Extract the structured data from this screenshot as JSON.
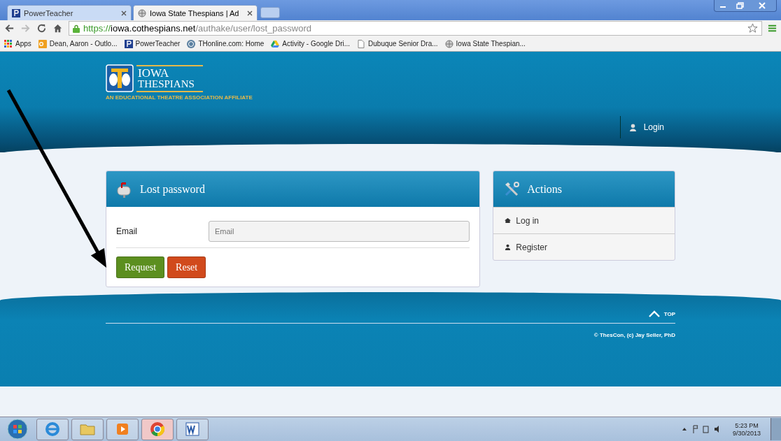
{
  "browser": {
    "tabs": [
      {
        "title": "PowerTeacher",
        "kind": "p",
        "selected": false
      },
      {
        "title": "Iowa State Thespians | Ad",
        "kind": "globe",
        "selected": true
      }
    ],
    "url": {
      "scheme": "https://",
      "host": "iowa.cothespians.net",
      "path": "/authake/user/lost_password"
    },
    "bookmarks": [
      {
        "label": "Apps",
        "kind": "apps"
      },
      {
        "label": "Dean, Aaron - Outlo...",
        "kind": "outlook"
      },
      {
        "label": "PowerTeacher",
        "kind": "p"
      },
      {
        "label": "THonline.com: Home",
        "kind": "th"
      },
      {
        "label": "Activity - Google Dri...",
        "kind": "drive"
      },
      {
        "label": "Dubuque Senior Dra...",
        "kind": "page"
      },
      {
        "label": "Iowa State Thespian...",
        "kind": "globe"
      }
    ]
  },
  "header": {
    "logo": {
      "line1": "IOWA",
      "line2": "THESPIANS",
      "tagline": "AN EDUCATIONAL THEATRE ASSOCIATION AFFILIATE"
    },
    "login": "Login"
  },
  "lost_password": {
    "title": "Lost password",
    "email_label": "Email",
    "email_placeholder": "Email",
    "buttons": [
      {
        "label": "Request",
        "kind": "primary"
      },
      {
        "label": "Reset",
        "kind": "danger"
      }
    ]
  },
  "actions": {
    "title": "Actions",
    "items": [
      {
        "label": "Log in",
        "kind": "home"
      },
      {
        "label": "Register",
        "kind": "user"
      }
    ]
  },
  "footer": {
    "top": "TOP",
    "copyright": "© ThesCon, (c) Jay Seller, PhD"
  },
  "taskbar": {
    "apps": [
      {
        "kind": "ie",
        "selected": false
      },
      {
        "kind": "folder",
        "selected": false
      },
      {
        "kind": "media",
        "selected": false
      },
      {
        "kind": "chrome",
        "selected": true
      },
      {
        "kind": "word",
        "selected": false
      }
    ],
    "time": "5:23 PM",
    "date": "9/30/2013"
  }
}
